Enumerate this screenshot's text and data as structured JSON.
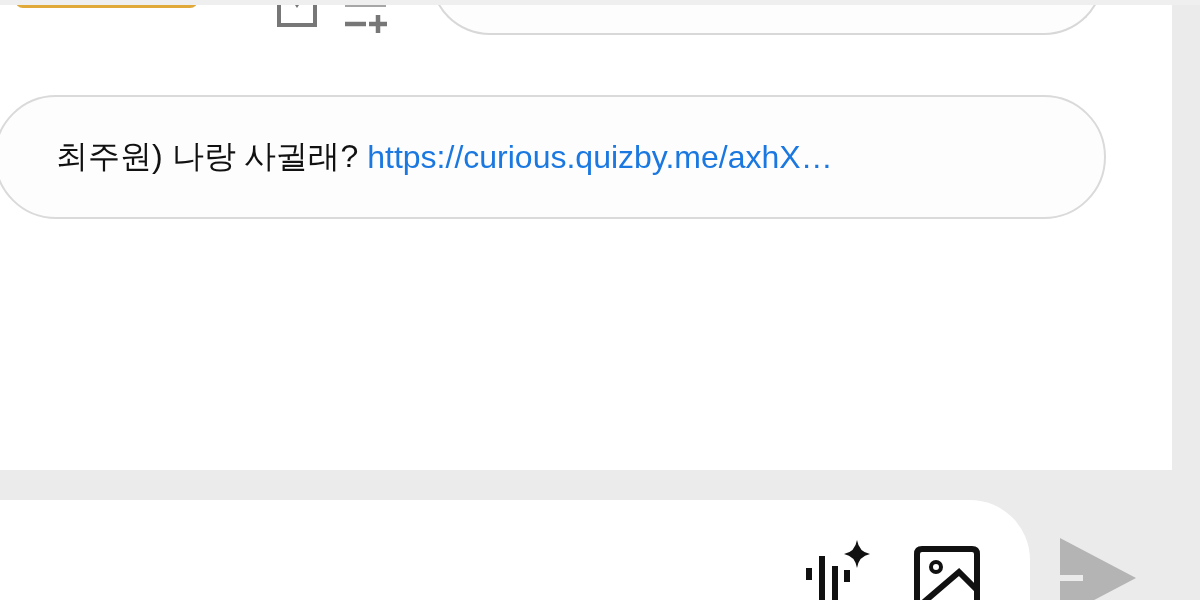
{
  "message": {
    "text": "최주원) 나랑 사귈래?",
    "link": "https://curious.quizby.me/axhX…"
  },
  "composer": {
    "send_disabled": true
  }
}
